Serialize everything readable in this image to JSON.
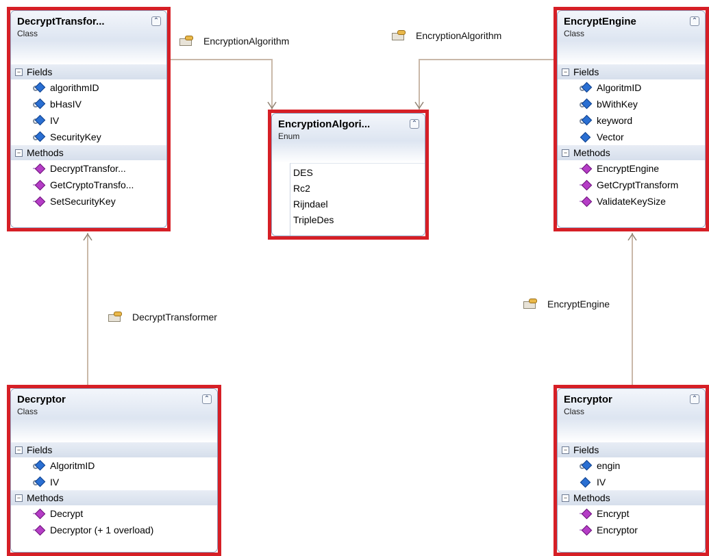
{
  "classes": {
    "decrypt_transformer": {
      "name": "DecryptTransfor...",
      "kind": "Class",
      "fields_label": "Fields",
      "fields": [
        "algorithmID",
        "bHasIV",
        "IV",
        "SecurityKey"
      ],
      "methods_label": "Methods",
      "methods": [
        "DecryptTransfor...",
        "GetCryptoTransfo...",
        "SetSecurityKey"
      ]
    },
    "encryption_algorithm": {
      "name": "EncryptionAlgori...",
      "kind": "Enum",
      "values": [
        "DES",
        "Rc2",
        "Rijndael",
        "TripleDes"
      ]
    },
    "encrypt_engine": {
      "name": "EncryptEngine",
      "kind": "Class",
      "fields_label": "Fields",
      "fields": [
        "AlgoritmID",
        "bWithKey",
        "keyword",
        "Vector"
      ],
      "methods_label": "Methods",
      "methods": [
        "EncryptEngine",
        "GetCryptTransform",
        "ValidateKeySize"
      ]
    },
    "decryptor": {
      "name": "Decryptor",
      "kind": "Class",
      "fields_label": "Fields",
      "fields": [
        "AlgoritmID",
        "IV"
      ],
      "methods_label": "Methods",
      "methods": [
        "Decrypt",
        "Decryptor (+ 1 overload)"
      ]
    },
    "encryptor": {
      "name": "Encryptor",
      "kind": "Class",
      "fields_label": "Fields",
      "fields": [
        "engin",
        "IV"
      ],
      "methods_label": "Methods",
      "methods": [
        "Encrypt",
        "Encryptor"
      ]
    }
  },
  "associations": {
    "left_enc_algo": "EncryptionAlgorithm",
    "right_enc_algo": "EncryptionAlgorithm",
    "decrypt_transformer": "DecryptTransformer",
    "encrypt_engine": "EncryptEngine"
  },
  "icons": {
    "collapse": "collapse-chevron-up",
    "section_toggle": "minus",
    "property": "property-icon",
    "field": "field-icon",
    "method": "method-icon"
  },
  "colors": {
    "highlight_border": "#d61f26",
    "connector": "#c9b8a8"
  }
}
